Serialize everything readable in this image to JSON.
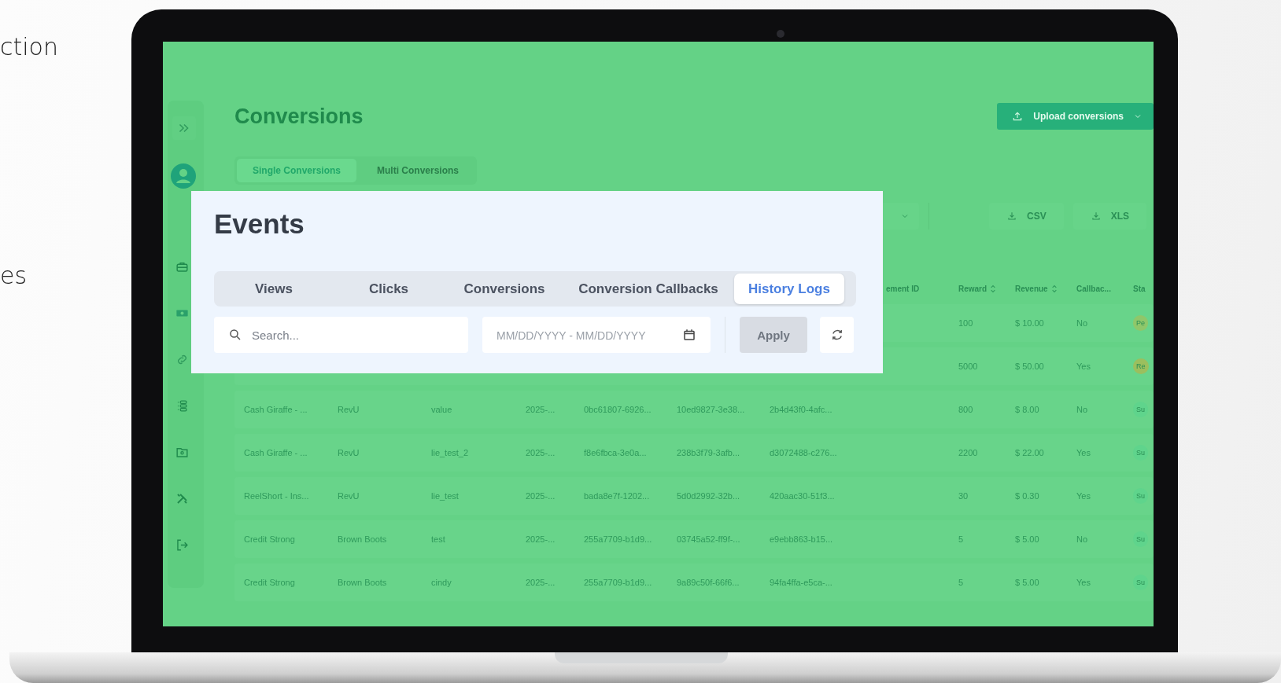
{
  "side_texts": [
    "ction",
    "es"
  ],
  "sidebar": {
    "items": [
      {
        "kind": "chevrons"
      },
      {
        "kind": "avatar"
      },
      {
        "kind": "briefcase"
      },
      {
        "kind": "money"
      },
      {
        "kind": "link"
      },
      {
        "kind": "list"
      },
      {
        "kind": "folder"
      },
      {
        "kind": "tools"
      },
      {
        "kind": "logout"
      }
    ]
  },
  "page": {
    "title": "Conversions",
    "upload_button": "Upload conversions",
    "tabs": [
      {
        "label": "Single Conversions",
        "selected": true
      },
      {
        "label": "Multi Conversions",
        "selected": false
      }
    ],
    "export_buttons": [
      "CSV",
      "XLS"
    ]
  },
  "table": {
    "columns": [
      {
        "label": "ement ID",
        "sortable": false
      },
      {
        "label": "Reward",
        "sortable": true
      },
      {
        "label": "Revenue",
        "sortable": true
      },
      {
        "label": "Callbac...",
        "sortable": false
      },
      {
        "label": "Sta",
        "sortable": false
      }
    ],
    "rows": [
      {
        "reward": "100",
        "revenue": "$ 10.00",
        "callback": "No",
        "status": {
          "label": "Pe",
          "color": "#8fc76a"
        }
      },
      {
        "reward": "5000",
        "revenue": "$ 50.00",
        "callback": "Yes",
        "status": {
          "label": "Re",
          "color": "#9bbf5e"
        }
      },
      {
        "cells": [
          "Cash Giraffe - ...",
          "RevU",
          "value",
          "2025-...",
          "0bc61807-6926...",
          "10ed9827-3e38...",
          "2b4d43f0-4afc..."
        ],
        "reward": "800",
        "revenue": "$ 8.00",
        "callback": "No",
        "status": {
          "label": "Su",
          "color": "#5fd48c"
        }
      },
      {
        "cells": [
          "Cash Giraffe - ...",
          "RevU",
          "lie_test_2",
          "2025-...",
          "f8e6fbca-3e0a...",
          "238b3f79-3afb...",
          "d3072488-c276..."
        ],
        "reward": "2200",
        "revenue": "$ 22.00",
        "callback": "Yes",
        "status": {
          "label": "Su",
          "color": "#5fd48c"
        }
      },
      {
        "cells": [
          "ReelShort - Ins...",
          "RevU",
          "lie_test",
          "2025-...",
          "bada8e7f-1202...",
          "5d0d2992-32b...",
          "420aac30-51f3..."
        ],
        "reward": "30",
        "revenue": "$ 0.30",
        "callback": "Yes",
        "status": {
          "label": "Su",
          "color": "#5fd48c"
        }
      },
      {
        "cells": [
          "Credit Strong",
          "Brown Boots",
          "test",
          "2025-...",
          "255a7709-b1d9...",
          "03745a52-ff9f-...",
          "e9ebb863-b15..."
        ],
        "reward": "5",
        "revenue": "$ 5.00",
        "callback": "No",
        "status": {
          "label": "Su",
          "color": "#5fd48c"
        }
      },
      {
        "cells": [
          "Credit Strong",
          "Brown Boots",
          "cindy",
          "2025-...",
          "255a7709-b1d9...",
          "9a89c50f-66f6...",
          "94fa4ffa-e5ca-..."
        ],
        "reward": "5",
        "revenue": "$ 5.00",
        "callback": "Yes",
        "status": {
          "label": "Su",
          "color": "#5fd48c"
        }
      }
    ]
  },
  "events": {
    "title": "Events",
    "tabs": [
      {
        "label": "Views",
        "selected": false
      },
      {
        "label": "Clicks",
        "selected": false
      },
      {
        "label": "Conversions",
        "selected": false
      },
      {
        "label": "Conversion Callbacks",
        "selected": false
      },
      {
        "label": "History Logs",
        "selected": true
      }
    ],
    "search": {
      "placeholder": "Search..."
    },
    "date_range": {
      "placeholder": "MM/DD/YYYY - MM/DD/YYYY"
    },
    "apply_button": {
      "label": "Apply",
      "disabled": true
    }
  }
}
